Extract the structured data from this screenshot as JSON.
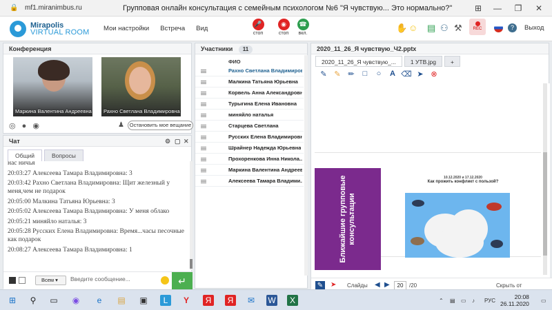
{
  "browser": {
    "url": "mf1.miranimbus.ru",
    "title": "Групповая онлайн консультация с семейным психологом №6 \"Я чувствую... Это нормально?\""
  },
  "app": {
    "logo_line1": "Mirapolis",
    "logo_line2": "VIRTUAL ROOM",
    "menu": [
      "Мои настройки",
      "Встреча",
      "Вид"
    ],
    "media": [
      {
        "label": "стоп",
        "color": "#e02424"
      },
      {
        "label": "стоп",
        "color": "#e02424"
      },
      {
        "label": "вкл.",
        "color": "#2e9e4f"
      }
    ],
    "rec_label": "REC",
    "exit_label": "Выход"
  },
  "conference": {
    "title": "Конференция",
    "videos": [
      {
        "name": "Маркина Валентина  Андреевна"
      },
      {
        "name": "Рахно Светлана  Владимировна"
      }
    ],
    "stop_broadcast": "Остановить мое вещание"
  },
  "chat": {
    "title": "Чат",
    "tabs": [
      "Общий",
      "Вопросы"
    ],
    "messages": [
      {
        "text": "нас ничья"
      },
      {
        "text": "20:03:27 Алексеева   Тамара  Владимировна: 3"
      },
      {
        "text": "20:03:42 Рахно Светлана  Владимировна: Щит железный у меня,чем не подарок"
      },
      {
        "text": "20:05:00 Малкина Татьяна  Юрьевна: 3"
      },
      {
        "text": "20:05:02 Алексеева   Тамара  Владимировна: У меня облако"
      },
      {
        "text": "20:05:21 миняйло  наталья: 3"
      },
      {
        "text": "20:05:28 Русских Елена Владимировна: Время...часы песочные как подарок"
      },
      {
        "text": "20:08:27 Алексеева   Тамара  Владимировна: 1"
      }
    ],
    "scope_select": "Всем",
    "input_placeholder": "Введите сообщение..."
  },
  "participants": {
    "title": "Участники",
    "count": "11",
    "column": "ФИО",
    "list": [
      "Рахно Светлана  Владимировна",
      "Малкина Татьяна  Юрьевна",
      "Корвель Анна  Александровна",
      "Турыгина  Елена  Ивановна",
      "миняйло  наталья",
      "Старцева  Светлана",
      "Русских Елена Владимировна",
      "Шрайнер Надежда  Юрьевна",
      "Прохоренкова  Инна  Никола...",
      "Маркина Валентина  Андреевна",
      "Алексеева   Тамара  Владими..."
    ]
  },
  "presentation": {
    "tabs": [
      "2020_11_26_Я чувствую_...",
      "1 УТВ.jpg",
      "+"
    ],
    "file_title": "2020_11_26_Я чувствую_Ч2.pptx",
    "slide": {
      "vertical_text": "Ближайшие групповые консультации",
      "dates": "10.12.2020 и 17.12.2020",
      "title": "Как прожить конфликт с пользой?"
    },
    "footer": {
      "slides_label": "Слайды",
      "current": "20",
      "total": "/20",
      "hide_label": "Скрыть от участников"
    }
  },
  "taskbar": {
    "lang": "РУС",
    "time": "20:08",
    "date": "26.11.2020"
  }
}
